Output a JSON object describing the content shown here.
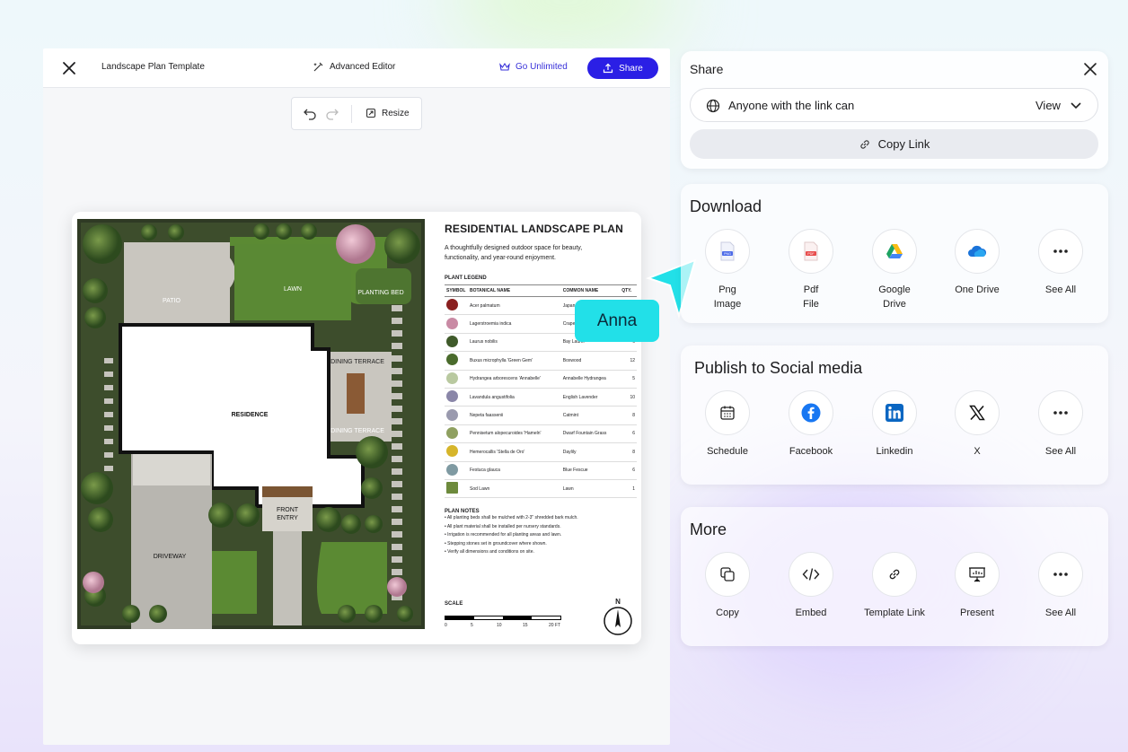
{
  "editor": {
    "doc_title": "Landscape Plan Template",
    "advanced_editor": "Advanced Editor",
    "go_unlimited": "Go Unlimited",
    "share": "Share",
    "resize": "Resize"
  },
  "plan": {
    "title": "RESIDENTIAL LANDSCAPE PLAN",
    "subtitle": "A thoughtfully designed outdoor space for beauty, functionality, and year-round enjoyment.",
    "areas": {
      "patio": "PATIO",
      "lawn": "LAWN",
      "planting_bed": "PLANTING BED",
      "dining_terrace_1": "DINING TERRACE",
      "dining_terrace_2": "DINING TERRACE",
      "residence": "RESIDENCE",
      "front_entry_1": "FRONT",
      "front_entry_2": "ENTRY",
      "driveway": "DRIVEWAY"
    },
    "legend_heading": "PLANT LEGEND",
    "legend_columns": [
      "SYMBOL",
      "BOTANICAL NAME",
      "COMMON NAME",
      "QTY."
    ],
    "legend_rows": [
      {
        "botanical": "Acer palmatum",
        "common": "Japanese",
        "qty": "",
        "color": "#8a1f1f"
      },
      {
        "botanical": "Lagerstroemia indica",
        "common": "Crape",
        "qty": "",
        "color": "#c98aa4"
      },
      {
        "botanical": "Laurus nobilis",
        "common": "Bay Laurel",
        "qty": "6",
        "color": "#3f5a2a"
      },
      {
        "botanical": "Buxus microphylla 'Green Gem'",
        "common": "Boxwood",
        "qty": "12",
        "color": "#4a6b2c"
      },
      {
        "botanical": "Hydrangea arborescens 'Annabelle'",
        "common": "Annabelle Hydrangea",
        "qty": "5",
        "color": "#b9c9a0"
      },
      {
        "botanical": "Lavandula angustifolia",
        "common": "English Lavender",
        "qty": "10",
        "color": "#8a86a8"
      },
      {
        "botanical": "Nepeta faassenii",
        "common": "Catmint",
        "qty": "8",
        "color": "#9a9aae"
      },
      {
        "botanical": "Pennisetum alopecuroides 'Hameln'",
        "common": "Dwarf Fountain Grass",
        "qty": "6",
        "color": "#8fa060"
      },
      {
        "botanical": "Hemerocallis 'Stella de Oro'",
        "common": "Daylily",
        "qty": "8",
        "color": "#d6b52a"
      },
      {
        "botanical": "Festuca glauca",
        "common": "Blue Fescue",
        "qty": "6",
        "color": "#7f9aa2"
      },
      {
        "botanical": "Sod Lawn",
        "common": "Lawn",
        "qty": "1",
        "color": "#6d8a3c"
      }
    ],
    "notes_heading": "PLAN NOTES",
    "notes": [
      "• All planting beds shall be mulched with 2-3\" shredded bark mulch.",
      "• All plant material shall be installed per nursery standards.",
      "• Irrigation is recommended for all planting areas and lawn.",
      "• Stepping stones set in groundcover where shown.",
      "• Verify all dimensions and conditions on site."
    ],
    "scale_heading": "SCALE",
    "scale_ticks": [
      "0",
      "5",
      "10",
      "15",
      "20 FT"
    ],
    "north": "N"
  },
  "collaborator": {
    "name": "Anna",
    "color": "#22e0e8"
  },
  "share_panel": {
    "title": "Share",
    "access_text": "Anyone with the link can",
    "access_role": "View",
    "copy_link": "Copy Link"
  },
  "download": {
    "title": "Download",
    "options": [
      {
        "line1": "Png",
        "line2": "Image",
        "icon": "png-file-icon"
      },
      {
        "line1": "Pdf",
        "line2": "File",
        "icon": "pdf-file-icon"
      },
      {
        "line1": "Google",
        "line2": "Drive",
        "icon": "google-drive-icon"
      },
      {
        "line1": "One Drive",
        "line2": "",
        "icon": "onedrive-icon"
      },
      {
        "line1": "See All",
        "line2": "",
        "icon": "more-icon"
      }
    ]
  },
  "social": {
    "title": "Publish to Social media",
    "options": [
      {
        "label": "Schedule",
        "icon": "calendar-icon"
      },
      {
        "label": "Facebook",
        "icon": "facebook-icon"
      },
      {
        "label": "Linkedin",
        "icon": "linkedin-icon"
      },
      {
        "label": "X",
        "icon": "x-icon"
      },
      {
        "label": "See All",
        "icon": "more-icon"
      }
    ]
  },
  "more": {
    "title": "More",
    "options": [
      {
        "label": "Copy",
        "icon": "copy-icon"
      },
      {
        "label": "Embed",
        "icon": "code-icon"
      },
      {
        "label": "Template Link",
        "icon": "link-icon"
      },
      {
        "label": "Present",
        "icon": "present-icon"
      },
      {
        "label": "See All",
        "icon": "more-icon"
      }
    ]
  },
  "colors": {
    "brand": "#2b1fe5",
    "accent_text": "#3730d9"
  }
}
